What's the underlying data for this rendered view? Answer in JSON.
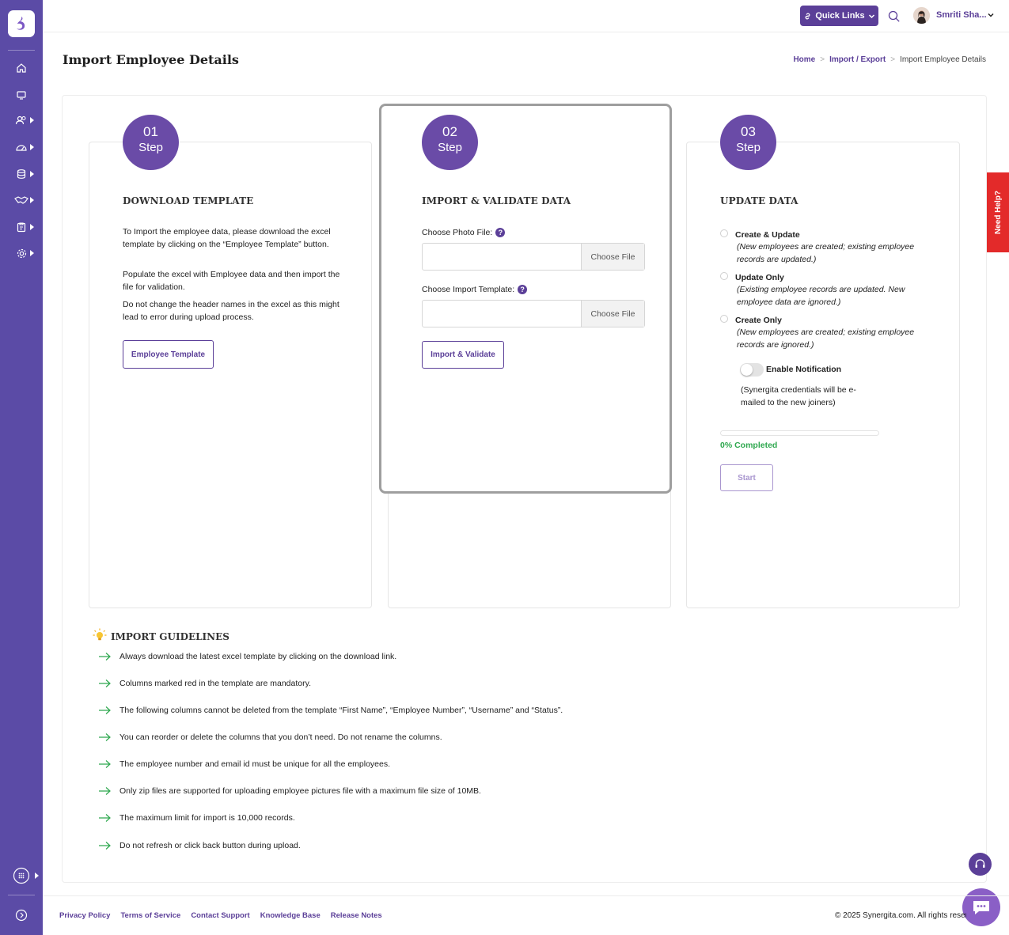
{
  "topbar": {
    "quick_links": "Quick Links",
    "user_name": "Smriti Sha..."
  },
  "page": {
    "title": "Import Employee Details"
  },
  "breadcrumb": {
    "home": "Home",
    "sep": ">",
    "import_export": "Import / Export",
    "current": "Import Employee Details"
  },
  "steps": [
    {
      "num": "01",
      "label": "Step",
      "title": "DOWNLOAD TEMPLATE",
      "paragraphs": [
        "To Import the employee data, please download the excel template by clicking on the “Employee Template” button.",
        "Populate the excel with Employee data and then import the file for validation.",
        "Do not change the header names in the excel as this might lead to error during upload process."
      ],
      "button": "Employee Template"
    },
    {
      "num": "02",
      "label": "Step",
      "title": "IMPORT & VALIDATE DATA",
      "photo_label": "Choose Photo File:",
      "template_label": "Choose Import Template:",
      "choose_file": "Choose File",
      "help": "?",
      "button": "Import & Validate"
    },
    {
      "num": "03",
      "label": "Step",
      "title": "UPDATE DATA",
      "options": [
        {
          "title": "Create & Update",
          "desc": "(New employees are created; existing employee records are updated.)"
        },
        {
          "title": "Update Only",
          "desc": "(Existing employee records are updated. New employee data are ignored.)"
        },
        {
          "title": "Create Only",
          "desc": "(New employees are created; existing employee records are ignored.)"
        }
      ],
      "notification_label": "Enable Notification",
      "notification_desc": "(Synergita credentials will be e-mailed to the new joiners)",
      "progress": 0,
      "progress_text": "0% Completed",
      "button": "Start"
    }
  ],
  "need_help": "Need Help?",
  "guidelines": {
    "title": "IMPORT GUIDELINES",
    "items": [
      "Always download the latest excel template by clicking on the download link.",
      "Columns marked red in the template are mandatory.",
      "The following columns cannot be deleted from the template “First Name”, “Employee Number”, “Username” and “Status”.",
      "You can reorder or delete the columns that you don’t need. Do not rename the columns.",
      "The employee number and email id must be unique for all the employees.",
      "Only zip files are supported for uploading employee pictures file with a maximum file size of 10MB.",
      "The maximum limit for import is 10,000 records.",
      "Do not refresh or click back button during upload."
    ]
  },
  "footer": {
    "links": [
      "Privacy Policy",
      "Terms of Service",
      "Contact Support",
      "Knowledge Base",
      "Release Notes"
    ],
    "copyright": "© 2025 Synergita.com. All rights reserved."
  },
  "colors": {
    "primary": "#5b3f98",
    "sidebar": "#5b4ba6",
    "step_badge": "#6a4ba7",
    "success": "#2fa84f",
    "help_tab": "#e32a2a"
  }
}
